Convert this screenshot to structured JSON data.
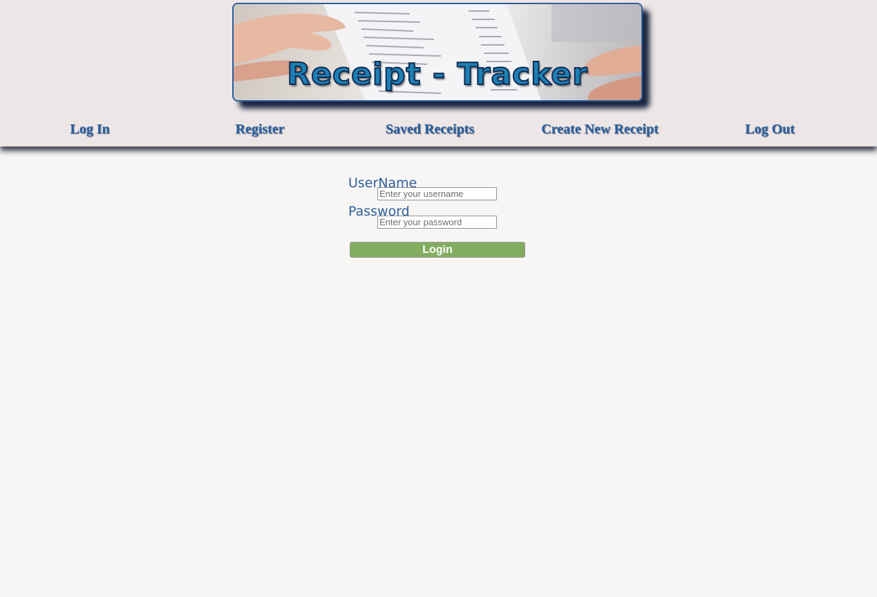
{
  "banner": {
    "title": "Receipt - Tracker"
  },
  "nav": {
    "items": [
      {
        "label": "Log In"
      },
      {
        "label": "Register"
      },
      {
        "label": "Saved Receipts"
      },
      {
        "label": "Create New Receipt"
      },
      {
        "label": "Log Out"
      }
    ]
  },
  "login_form": {
    "username_label": "UserName",
    "username_placeholder": "Enter your username",
    "username_value": "",
    "password_label": "Password",
    "password_placeholder": "Enter your password",
    "password_value": "",
    "submit_label": "Login"
  },
  "colors": {
    "header_background": "#ede6e6",
    "page_background": "#f7f6f5",
    "nav_text": "#2860a0",
    "label_text": "#2f5f9a",
    "login_button": "#82ad61"
  }
}
